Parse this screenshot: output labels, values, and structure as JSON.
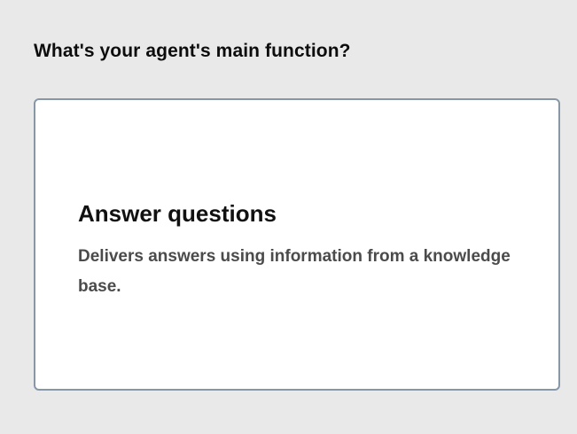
{
  "question": {
    "title": "What's your agent's main function?"
  },
  "options": [
    {
      "title": "Answer questions",
      "description": "Delivers answers using information from a knowledge base."
    }
  ],
  "colors": {
    "page_background": "#e9e9e9",
    "card_background": "#ffffff",
    "card_border": "#8797a8",
    "title_text": "#111111",
    "description_text": "#4b4b4b"
  }
}
